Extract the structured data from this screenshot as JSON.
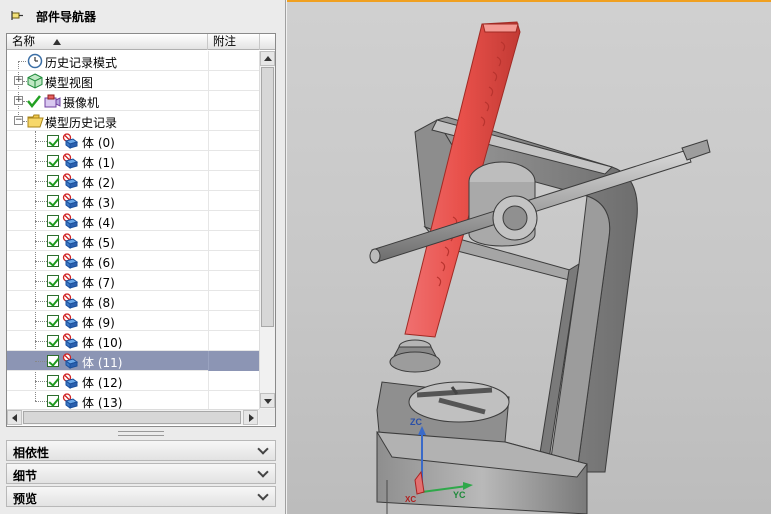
{
  "navigator": {
    "title": "部件导航器",
    "columns": {
      "name": "名称",
      "note": "附注"
    },
    "nodes": [
      {
        "label": "历史记录模式"
      },
      {
        "label": "模型视图"
      },
      {
        "label": "摄像机"
      },
      {
        "label": "模型历史记录"
      }
    ],
    "bodies": [
      {
        "label": "体 (0)"
      },
      {
        "label": "体 (1)"
      },
      {
        "label": "体 (2)"
      },
      {
        "label": "体 (3)"
      },
      {
        "label": "体 (4)"
      },
      {
        "label": "体 (5)"
      },
      {
        "label": "体 (6)"
      },
      {
        "label": "体 (7)"
      },
      {
        "label": "体 (8)"
      },
      {
        "label": "体 (9)"
      },
      {
        "label": "体 (10)"
      },
      {
        "label": "体 (11)",
        "selected": true
      },
      {
        "label": "体 (12)"
      },
      {
        "label": "体 (13)"
      }
    ]
  },
  "panels": {
    "dependency": "相依性",
    "details": "细节",
    "preview": "预览"
  },
  "viewport": {
    "axis_labels": {
      "zc": "ZC",
      "yc": "YC",
      "xc": "XC"
    },
    "highlight_color": "#e8504a",
    "background_color": "#c8c8c8",
    "accent_border_color": "#f0a020"
  }
}
